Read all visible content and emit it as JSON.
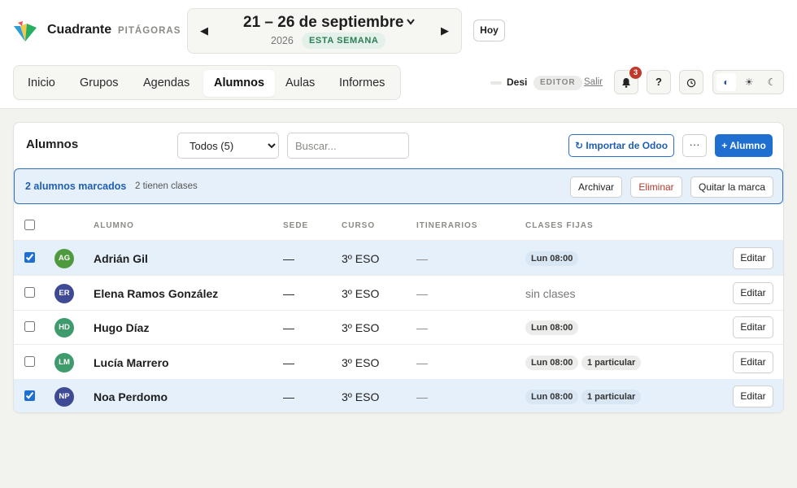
{
  "header": {
    "brand": "Cuadrante",
    "org": "PITÁGORAS",
    "week": {
      "prev_icon": "chevron-left-icon",
      "next_icon": "chevron-right-icon",
      "range": "21 – 26 de septiembre",
      "year": "2026",
      "badge": "ESTA SEMANA"
    },
    "today_label": "Hoy"
  },
  "nav": {
    "tabs": [
      {
        "label": "Inicio",
        "active": false
      },
      {
        "label": "Grupos",
        "active": false
      },
      {
        "label": "Agendas",
        "active": false
      },
      {
        "label": "Alumnos",
        "active": true
      },
      {
        "label": "Aulas",
        "active": false
      },
      {
        "label": "Informes",
        "active": false
      }
    ]
  },
  "user": {
    "name": "Desi",
    "role": "EDITOR",
    "logout_label": "Salir",
    "notifications": "3",
    "help_label": "?"
  },
  "theme": {
    "options": [
      "contrast-icon",
      "sun-icon",
      "moon-icon"
    ],
    "active": "contrast-icon"
  },
  "card": {
    "title": "Alumnos",
    "filter": {
      "selected": "Todos (5)"
    },
    "search": {
      "placeholder": "Buscar...",
      "value": ""
    },
    "import_label": "↻ Importar de Odoo",
    "more_label": "···",
    "add_label": "+ Alumno"
  },
  "selection": {
    "count_label": "2 alumnos marcados",
    "info": "2 tienen clases",
    "archive_label": "Archivar",
    "delete_label": "Eliminar",
    "unmark_label": "Quitar la marca"
  },
  "table": {
    "columns": [
      "ALUMNO",
      "SEDE",
      "CURSO",
      "ITINERARIOS",
      "CLASES FIJAS"
    ],
    "edit_label": "Editar",
    "rows": [
      {
        "initials": "AG",
        "name": "Adrián Gil",
        "sede": "—",
        "curso": "3º ESO",
        "itinerarios": "—",
        "clases": [
          "Lun 08:00"
        ],
        "no_classes": "",
        "checked": true,
        "avatar_color": "#4f9a3f"
      },
      {
        "initials": "ER",
        "name": "Elena Ramos González",
        "sede": "—",
        "curso": "3º ESO",
        "itinerarios": "—",
        "clases": [],
        "no_classes": "sin clases",
        "checked": false,
        "avatar_color": "#3f4a95"
      },
      {
        "initials": "HD",
        "name": "Hugo Díaz",
        "sede": "—",
        "curso": "3º ESO",
        "itinerarios": "—",
        "clases": [
          "Lun 08:00"
        ],
        "no_classes": "",
        "checked": false,
        "avatar_color": "#3f9a6c"
      },
      {
        "initials": "LM",
        "name": "Lucía Marrero",
        "sede": "—",
        "curso": "3º ESO",
        "itinerarios": "—",
        "clases": [
          "Lun 08:00",
          "1 particular"
        ],
        "no_classes": "",
        "checked": false,
        "avatar_color": "#3f9a6c"
      },
      {
        "initials": "NP",
        "name": "Noa Perdomo",
        "sede": "—",
        "curso": "3º ESO",
        "itinerarios": "—",
        "clases": [
          "Lun 08:00",
          "1 particular"
        ],
        "no_classes": "",
        "checked": true,
        "avatar_color": "#3f4a95"
      }
    ]
  }
}
